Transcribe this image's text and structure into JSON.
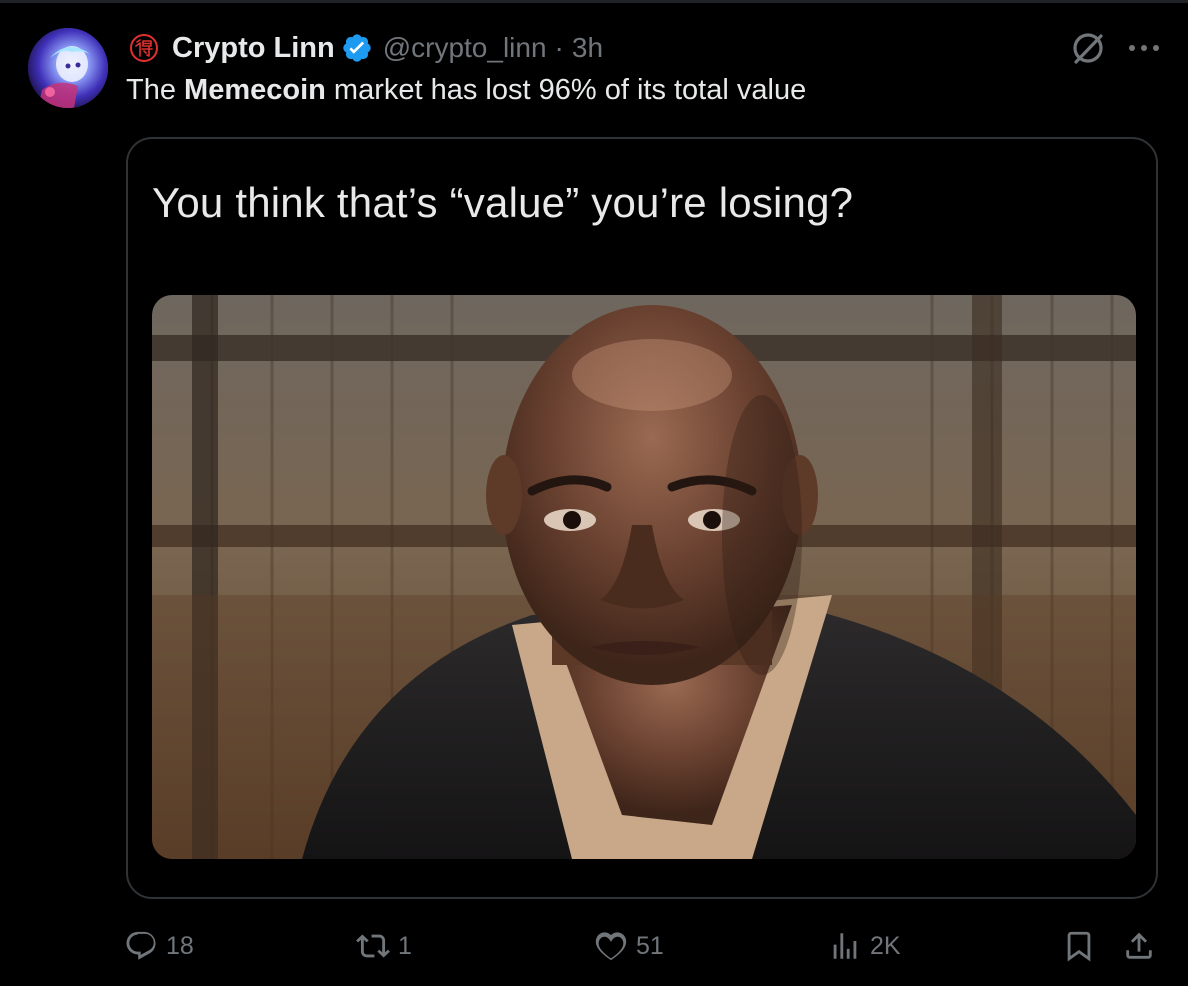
{
  "post": {
    "author": {
      "display_name": "Crypto Linn",
      "handle": "@crypto_linn",
      "separator": "·",
      "time": "3h"
    },
    "text": {
      "prefix": "The ",
      "bold": "Memecoin",
      "suffix": " market has lost 96% of its total value"
    },
    "media": {
      "caption": "You think that’s “value” you’re losing?"
    },
    "metrics": {
      "replies": "18",
      "reposts": "1",
      "likes": "51",
      "views": "2K"
    }
  },
  "colors": {
    "background": "#000000",
    "primary_text": "#e7e9ea",
    "secondary_text": "#71767b",
    "verified_blue": "#1d9bf0",
    "card_border": "#2f3336",
    "badge_red": "#e0312f"
  },
  "icons": {
    "grok": "grok-icon",
    "more": "more-icon",
    "reply": "reply-icon",
    "repost": "repost-icon",
    "like": "heart-icon",
    "views": "views-icon",
    "bookmark": "bookmark-icon",
    "share": "share-icon",
    "verified": "verified-badge-icon"
  }
}
